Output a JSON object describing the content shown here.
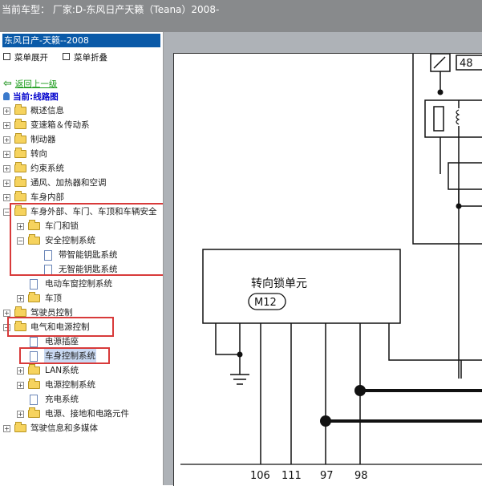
{
  "header": {
    "title": "当前车型： 厂家:D-东风日产天籁（Teana）2008-"
  },
  "sidebar": {
    "title": "东风日产-天籁--2008",
    "expand_menu": "菜单展开",
    "collapse_menu": "菜单折叠",
    "back": "返回上一级",
    "current": "当前:线路图",
    "tree": [
      {
        "label": "概述信息"
      },
      {
        "label": "变速箱＆传动系"
      },
      {
        "label": "制动器"
      },
      {
        "label": "转向"
      },
      {
        "label": "约束系统"
      },
      {
        "label": "通风、加热器和空调"
      },
      {
        "label": "车身内部"
      },
      {
        "label": "车身外部、车门、车顶和车辆安全"
      },
      {
        "label": "车门和锁"
      },
      {
        "label": "安全控制系统"
      },
      {
        "label": "带智能钥匙系统"
      },
      {
        "label": "无智能钥匙系统"
      },
      {
        "label": "电动车窗控制系统"
      },
      {
        "label": "车顶"
      },
      {
        "label": "驾驶员控制"
      },
      {
        "label": "电气和电源控制"
      },
      {
        "label": "电源插座"
      },
      {
        "label": "车身控制系统"
      },
      {
        "label": "LAN系统"
      },
      {
        "label": "电源控制系统"
      },
      {
        "label": "充电系统"
      },
      {
        "label": "电源、接地和电路元件"
      },
      {
        "label": "驾驶信息和多媒体"
      }
    ]
  },
  "diagram": {
    "unit_name": "转向锁单元",
    "unit_code": "M12",
    "connector": "48",
    "terminals": [
      "106",
      "111",
      "97",
      "98"
    ]
  }
}
